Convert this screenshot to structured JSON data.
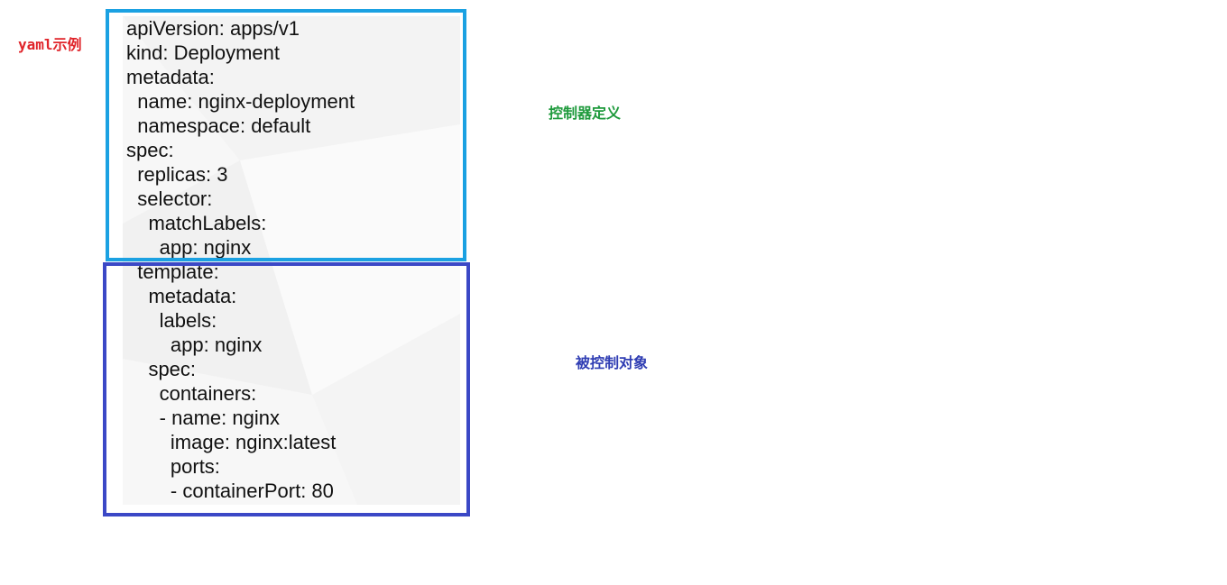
{
  "captions": {
    "yaml_example": "yaml示例",
    "controller_definition": "控制器定义",
    "controlled_object": "被控制对象"
  },
  "colors": {
    "yaml_example_text": "#e0242a",
    "controller_definition_text": "#1e9a3c",
    "controlled_object_text": "#2f3db3",
    "controller_box_border": "#1ba1e2",
    "controlled_box_border": "#3b48c6",
    "code_background": "#f7f7f7"
  },
  "code_lines": [
    "apiVersion: apps/v1",
    "kind: Deployment",
    "metadata:",
    "  name: nginx-deployment",
    "  namespace: default",
    "spec:",
    "  replicas: 3",
    "  selector:",
    "    matchLabels:",
    "      app: nginx",
    "  template:",
    "    metadata:",
    "      labels:",
    "        app: nginx",
    "    spec:",
    "      containers:",
    "      - name: nginx",
    "        image: nginx:latest",
    "        ports:",
    "        - containerPort: 80"
  ]
}
